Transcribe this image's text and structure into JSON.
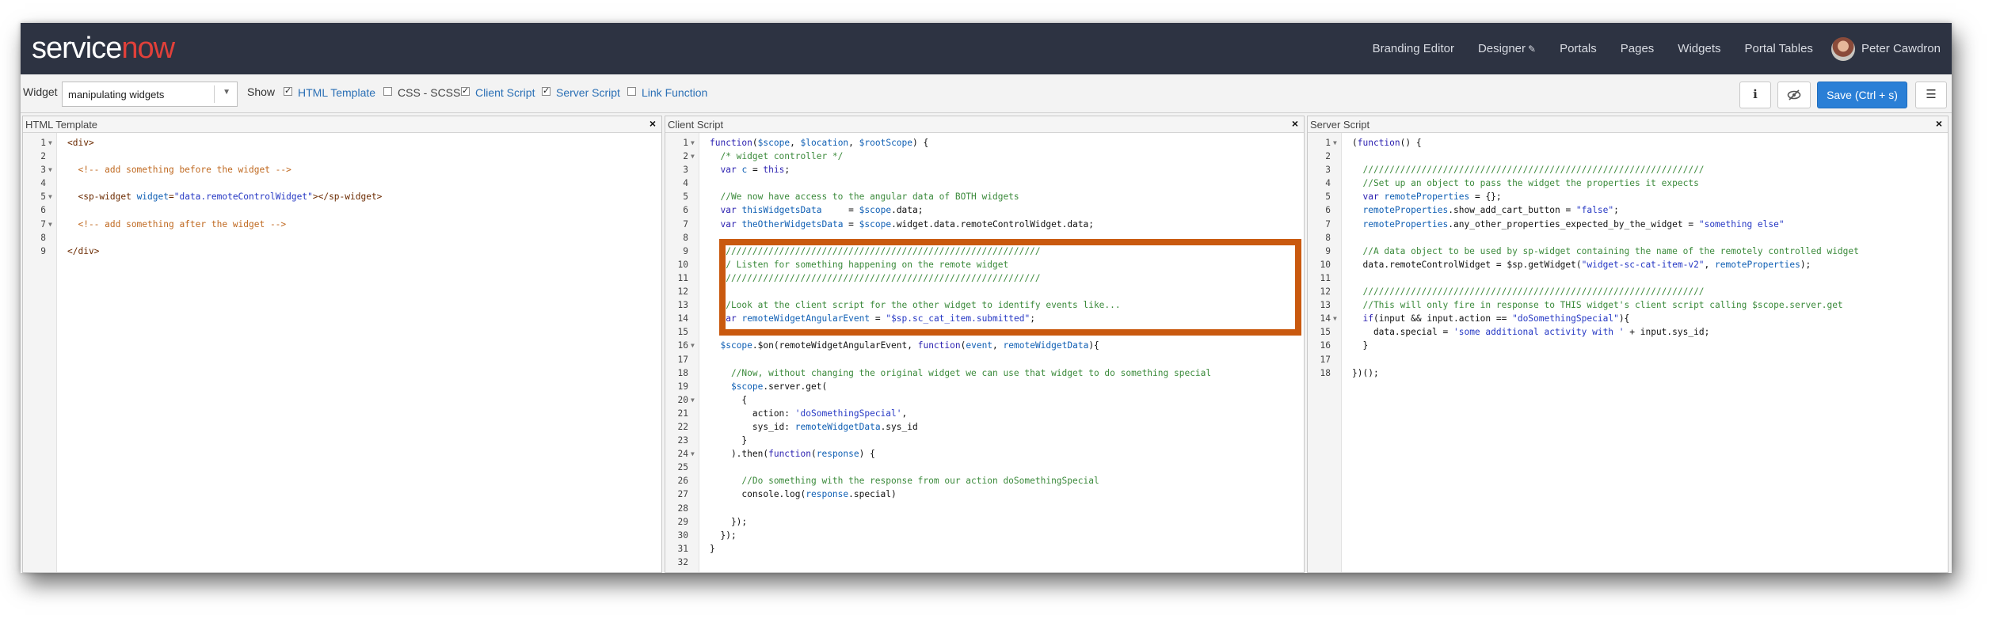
{
  "navbar": {
    "logo_service": "service",
    "logo_now": "now",
    "links": [
      "Branding Editor",
      "Designer",
      "Portals",
      "Pages",
      "Widgets",
      "Portal Tables"
    ],
    "designer_pencil": "✎",
    "user_name": "Peter Cawdron"
  },
  "toolbar": {
    "widget_label": "Widget",
    "widget_value": "manipulating widgets",
    "show_label": "Show",
    "options": [
      {
        "label": "HTML Template",
        "checked": true
      },
      {
        "label": "CSS - SCSS",
        "checked": false
      },
      {
        "label": "Client Script",
        "checked": true
      },
      {
        "label": "Server Script",
        "checked": true
      },
      {
        "label": "Link Function",
        "checked": false
      }
    ],
    "info_icon": "ℹ",
    "save_label": "Save (Ctrl + s)",
    "menu_icon": "☰"
  },
  "panes": [
    {
      "title": "HTML Template",
      "lines": [
        [
          [
            "tg",
            "<div>"
          ]
        ],
        [],
        [
          [
            "cm",
            "  <!-- add something before the widget -->"
          ]
        ],
        [],
        [
          [
            "tg",
            "  <sp-widget "
          ],
          [
            "v",
            "widget"
          ],
          [
            "tg",
            "="
          ],
          [
            "s",
            "\"data.remoteControlWidget\""
          ],
          [
            "tg",
            "></sp-widget>"
          ]
        ],
        [],
        [
          [
            "cm",
            "  <!-- add something after the widget -->"
          ]
        ],
        [],
        [
          [
            "tg",
            "</div>"
          ]
        ]
      ],
      "folds": [
        1,
        3,
        5,
        7
      ]
    },
    {
      "title": "Client Script",
      "lines": [
        [
          [
            "k",
            "function"
          ],
          [
            "t",
            "("
          ],
          [
            "v",
            "$scope"
          ],
          [
            "t",
            ", "
          ],
          [
            "v",
            "$location"
          ],
          [
            "t",
            ", "
          ],
          [
            "v",
            "$rootScope"
          ],
          [
            "t",
            ") {"
          ]
        ],
        [
          [
            "c",
            "  /* widget controller */"
          ]
        ],
        [
          [
            "t",
            "  "
          ],
          [
            "k",
            "var"
          ],
          [
            "t",
            " "
          ],
          [
            "v",
            "c"
          ],
          [
            "t",
            " = "
          ],
          [
            "k",
            "this"
          ],
          [
            "t",
            ";"
          ]
        ],
        [],
        [
          [
            "c",
            "  //We now have access to the angular data of BOTH widgets"
          ]
        ],
        [
          [
            "t",
            "  "
          ],
          [
            "k",
            "var"
          ],
          [
            "t",
            " "
          ],
          [
            "v",
            "thisWidgetsData"
          ],
          [
            "t",
            "     = "
          ],
          [
            "v",
            "$scope"
          ],
          [
            "t",
            ".data;"
          ]
        ],
        [
          [
            "t",
            "  "
          ],
          [
            "k",
            "var"
          ],
          [
            "t",
            " "
          ],
          [
            "v",
            "theOtherWidgetsData"
          ],
          [
            "t",
            " = "
          ],
          [
            "v",
            "$scope"
          ],
          [
            "t",
            ".widget.data.remoteControlWidget.data;"
          ]
        ],
        [],
        [
          [
            "c",
            "  ////////////////////////////////////////////////////////////"
          ]
        ],
        [
          [
            "c",
            "  // Listen for something happening on the remote widget"
          ]
        ],
        [
          [
            "c",
            "  ////////////////////////////////////////////////////////////"
          ]
        ],
        [],
        [
          [
            "c",
            "  //Look at the client script for the other widget to identify events like..."
          ]
        ],
        [
          [
            "t",
            "  "
          ],
          [
            "k",
            "var"
          ],
          [
            "t",
            " "
          ],
          [
            "v",
            "remoteWidgetAngularEvent"
          ],
          [
            "t",
            " = "
          ],
          [
            "s",
            "\"$sp.sc_cat_item.submitted\""
          ],
          [
            "t",
            ";"
          ]
        ],
        [],
        [
          [
            "t",
            "  "
          ],
          [
            "v",
            "$scope"
          ],
          [
            "t",
            ".$on("
          ],
          [
            "t",
            "remoteWidgetAngularEvent, "
          ],
          [
            "k",
            "function"
          ],
          [
            "t",
            "("
          ],
          [
            "v",
            "event"
          ],
          [
            "t",
            ", "
          ],
          [
            "v",
            "remoteWidgetData"
          ],
          [
            "t",
            "){"
          ]
        ],
        [],
        [
          [
            "c",
            "    //Now, without changing the original widget we can use that widget to do something special"
          ]
        ],
        [
          [
            "t",
            "    "
          ],
          [
            "v",
            "$scope"
          ],
          [
            "t",
            ".server.get("
          ]
        ],
        [
          [
            "t",
            "      {"
          ]
        ],
        [
          [
            "t",
            "        action: "
          ],
          [
            "s",
            "'doSomethingSpecial'"
          ],
          [
            "t",
            ","
          ]
        ],
        [
          [
            "t",
            "        sys_id: "
          ],
          [
            "v",
            "remoteWidgetData"
          ],
          [
            "t",
            ".sys_id"
          ]
        ],
        [
          [
            "t",
            "      }"
          ]
        ],
        [
          [
            "t",
            "    ).then("
          ],
          [
            "k",
            "function"
          ],
          [
            "t",
            "("
          ],
          [
            "v",
            "response"
          ],
          [
            "t",
            ") {"
          ]
        ],
        [],
        [
          [
            "c",
            "      //Do something with the response from our action doSomethingSpecial"
          ]
        ],
        [
          [
            "t",
            "      console.log("
          ],
          [
            "v",
            "response"
          ],
          [
            "t",
            ".special)"
          ]
        ],
        [],
        [
          [
            "t",
            "    });"
          ]
        ],
        [
          [
            "t",
            "  });"
          ]
        ],
        [
          [
            "t",
            "}"
          ]
        ],
        []
      ],
      "folds": [
        1,
        2,
        16,
        20,
        24
      ]
    },
    {
      "title": "Server Script",
      "lines": [
        [
          [
            "t",
            "("
          ],
          [
            "k",
            "function"
          ],
          [
            "t",
            "() {"
          ]
        ],
        [],
        [
          [
            "c",
            "  ////////////////////////////////////////////////////////////////"
          ]
        ],
        [
          [
            "c",
            "  //Set up an object to pass the widget the properties it expects"
          ]
        ],
        [
          [
            "t",
            "  "
          ],
          [
            "k",
            "var"
          ],
          [
            "t",
            " "
          ],
          [
            "v",
            "remoteProperties"
          ],
          [
            "t",
            " = {};"
          ]
        ],
        [
          [
            "t",
            "  "
          ],
          [
            "v",
            "remoteProperties"
          ],
          [
            "t",
            ".show_add_cart_button = "
          ],
          [
            "s",
            "\"false\""
          ],
          [
            "t",
            ";"
          ]
        ],
        [
          [
            "t",
            "  "
          ],
          [
            "v",
            "remoteProperties"
          ],
          [
            "t",
            ".any_other_properties_expected_by_the_widget = "
          ],
          [
            "s",
            "\"something else\""
          ]
        ],
        [],
        [
          [
            "c",
            "  //A data object to be used by sp-widget containing the name of the remotely controlled widget"
          ]
        ],
        [
          [
            "t",
            "  data.remoteControlWidget = $sp.getWidget("
          ],
          [
            "s",
            "\"widget-sc-cat-item-v2\""
          ],
          [
            "t",
            ", "
          ],
          [
            "v",
            "remoteProperties"
          ],
          [
            "t",
            ");"
          ]
        ],
        [],
        [
          [
            "c",
            "  ////////////////////////////////////////////////////////////////"
          ]
        ],
        [
          [
            "c",
            "  //This will only fire in response to THIS widget's client script calling $scope.server.get"
          ]
        ],
        [
          [
            "t",
            "  "
          ],
          [
            "k",
            "if"
          ],
          [
            "t",
            "(input && input.action == "
          ],
          [
            "s",
            "\"doSomethingSpecial\""
          ],
          [
            "t",
            "){"
          ]
        ],
        [
          [
            "t",
            "    data.special = "
          ],
          [
            "s",
            "'some additional activity with '"
          ],
          [
            "t",
            " + input.sys_id;"
          ]
        ],
        [
          [
            "t",
            "  }"
          ]
        ],
        [],
        [
          [
            "t",
            "})();"
          ]
        ]
      ],
      "folds": [
        1,
        14
      ]
    }
  ],
  "colors": {
    "navbar_bg": "#2d3342",
    "accent_blue": "#2a7fd6",
    "highlight_box": "#c9590f"
  }
}
